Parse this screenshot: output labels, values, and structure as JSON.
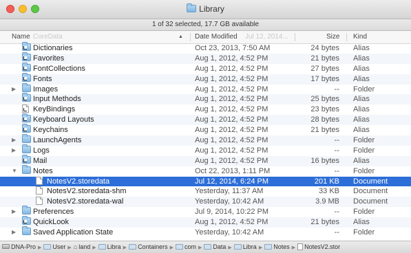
{
  "window": {
    "title": "Library"
  },
  "status": "1 of 32 selected, 17.7 GB available",
  "columns": {
    "name": "Name",
    "name_ghost": "CoreData",
    "date": "Date Modified",
    "date_ghost": "Jul 12, 2014...",
    "size": "Size",
    "kind": "Kind"
  },
  "rows": [
    {
      "name": "Dictionaries",
      "date": "Oct 23, 2013, 7:50 AM",
      "size": "24 bytes",
      "kind": "Alias",
      "icon": "folder-alias-icon",
      "disclosure": ""
    },
    {
      "name": "Favorites",
      "date": "Aug 1, 2012, 4:52 PM",
      "size": "21 bytes",
      "kind": "Alias",
      "icon": "folder-alias-icon",
      "disclosure": ""
    },
    {
      "name": "FontCollections",
      "date": "Aug 1, 2012, 4:52 PM",
      "size": "27 bytes",
      "kind": "Alias",
      "icon": "folder-alias-icon",
      "disclosure": ""
    },
    {
      "name": "Fonts",
      "date": "Aug 1, 2012, 4:52 PM",
      "size": "17 bytes",
      "kind": "Alias",
      "icon": "folder-alias-icon",
      "disclosure": ""
    },
    {
      "name": "Images",
      "date": "Aug 1, 2012, 4:52 PM",
      "size": "--",
      "kind": "Folder",
      "icon": "folder-icon",
      "disclosure": "▶"
    },
    {
      "name": "Input Methods",
      "date": "Aug 1, 2012, 4:52 PM",
      "size": "25 bytes",
      "kind": "Alias",
      "icon": "folder-alias-icon",
      "disclosure": ""
    },
    {
      "name": "KeyBindings",
      "date": "Aug 1, 2012, 4:52 PM",
      "size": "23 bytes",
      "kind": "Alias",
      "icon": "document-alias-icon",
      "disclosure": ""
    },
    {
      "name": "Keyboard Layouts",
      "date": "Aug 1, 2012, 4:52 PM",
      "size": "28 bytes",
      "kind": "Alias",
      "icon": "folder-alias-icon",
      "disclosure": ""
    },
    {
      "name": "Keychains",
      "date": "Aug 1, 2012, 4:52 PM",
      "size": "21 bytes",
      "kind": "Alias",
      "icon": "folder-alias-icon",
      "disclosure": ""
    },
    {
      "name": "LaunchAgents",
      "date": "Aug 1, 2012, 4:52 PM",
      "size": "--",
      "kind": "Folder",
      "icon": "folder-icon",
      "disclosure": "▶"
    },
    {
      "name": "Logs",
      "date": "Aug 1, 2012, 4:52 PM",
      "size": "--",
      "kind": "Folder",
      "icon": "folder-icon",
      "disclosure": "▶"
    },
    {
      "name": "Mail",
      "date": "Aug 1, 2012, 4:52 PM",
      "size": "16 bytes",
      "kind": "Alias",
      "icon": "folder-alias-icon",
      "disclosure": ""
    },
    {
      "name": "Notes",
      "date": "Oct 22, 2013, 1:11 PM",
      "size": "--",
      "kind": "Folder",
      "icon": "folder-icon",
      "disclosure": "▼"
    },
    {
      "name": "NotesV2.storedata",
      "date": "Jul 12, 2014, 6:24 PM",
      "size": "201 KB",
      "kind": "Document",
      "icon": "document-icon",
      "disclosure": "",
      "child": true,
      "selected": true
    },
    {
      "name": "NotesV2.storedata-shm",
      "date": "Yesterday, 11:37 AM",
      "size": "33 KB",
      "kind": "Document",
      "icon": "document-icon",
      "disclosure": "",
      "child": true
    },
    {
      "name": "NotesV2.storedata-wal",
      "date": "Yesterday, 10:42 AM",
      "size": "3.9 MB",
      "kind": "Document",
      "icon": "document-icon",
      "disclosure": "",
      "child": true
    },
    {
      "name": "Preferences",
      "date": "Jul 9, 2014, 10:22 PM",
      "size": "--",
      "kind": "Folder",
      "icon": "folder-icon",
      "disclosure": "▶"
    },
    {
      "name": "QuickLook",
      "date": "Aug 1, 2012, 4:52 PM",
      "size": "21 bytes",
      "kind": "Alias",
      "icon": "folder-alias-icon",
      "disclosure": ""
    },
    {
      "name": "Saved Application State",
      "date": "Yesterday, 10:42 AM",
      "size": "--",
      "kind": "Folder",
      "icon": "folder-icon",
      "disclosure": "▶"
    }
  ],
  "path": [
    {
      "label": "DNA-Pro",
      "icon": "disk-icon"
    },
    {
      "label": "User",
      "icon": "folder-icon"
    },
    {
      "label": "land",
      "icon": "home-icon"
    },
    {
      "label": "Libra",
      "icon": "folder-icon"
    },
    {
      "label": "Containers",
      "icon": "folder-icon"
    },
    {
      "label": "com",
      "icon": "folder-icon"
    },
    {
      "label": "Data",
      "icon": "folder-icon"
    },
    {
      "label": "Libra",
      "icon": "folder-icon"
    },
    {
      "label": "Notes",
      "icon": "folder-icon"
    },
    {
      "label": "NotesV2.stor",
      "icon": "document-icon"
    }
  ],
  "colors": {
    "selection": "#2d6ed8",
    "alt_row": "#f3f6fa"
  }
}
